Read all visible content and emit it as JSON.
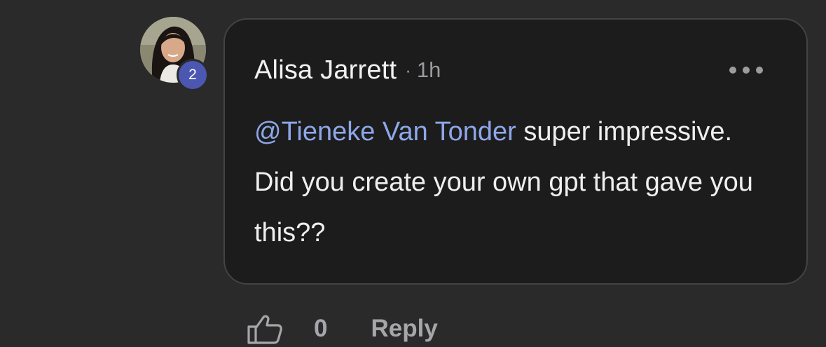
{
  "comment": {
    "author_name": "Alisa Jarrett",
    "separator": "·",
    "timestamp": "1h",
    "level_badge": "2",
    "mention": "@Tieneke Van Tonder",
    "body_text": " super impressive. Did you create your own gpt that gave you this??",
    "like_count": "0",
    "reply_label": "Reply",
    "more_icon": "more-horizontal-icon",
    "like_icon": "thumbs-up-icon"
  },
  "colors": {
    "background": "#2a2a2b",
    "bubble": "#1c1c1d",
    "mention": "#8ea7e8",
    "badge": "#4b57b1"
  }
}
